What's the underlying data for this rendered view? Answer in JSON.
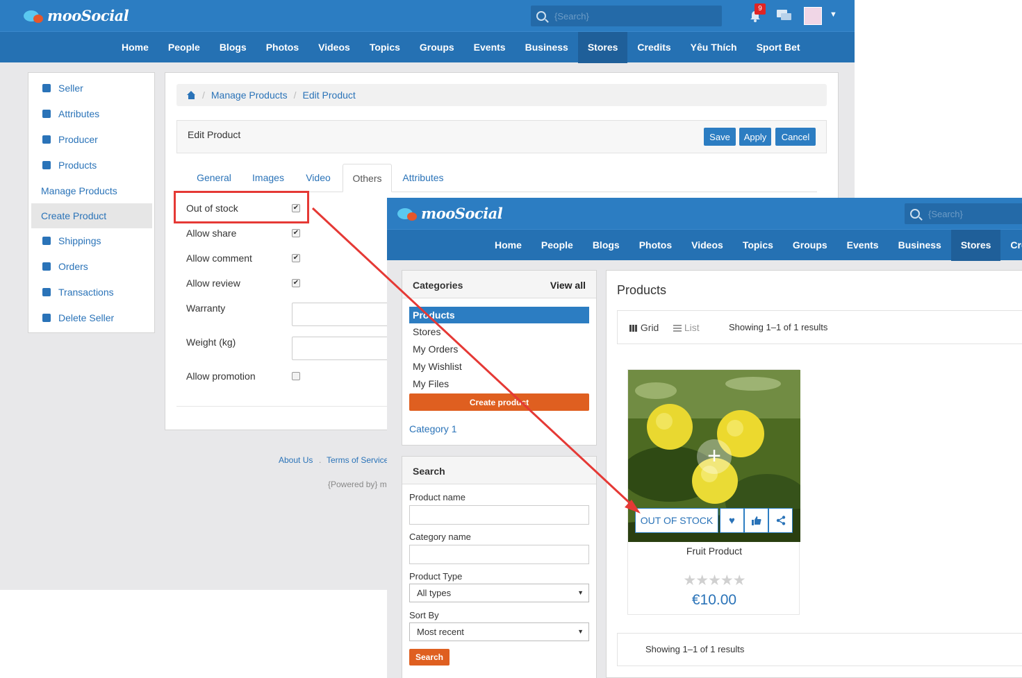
{
  "brand": "mooSocial",
  "search_placeholder": "{Search}",
  "notification_count": "9",
  "nav": [
    "Home",
    "People",
    "Blogs",
    "Photos",
    "Videos",
    "Topics",
    "Groups",
    "Events",
    "Business",
    "Stores",
    "Credits",
    "Yêu Thích",
    "Sport Bet"
  ],
  "front_nav": [
    "Home",
    "People",
    "Blogs",
    "Photos",
    "Videos",
    "Topics",
    "Groups",
    "Events",
    "Business",
    "Stores",
    "Credits"
  ],
  "sidebar": [
    "Seller",
    "Attributes",
    "Producer",
    "Products",
    "Manage Products",
    "Create Product",
    "Shippings",
    "Orders",
    "Transactions",
    "Delete Seller"
  ],
  "breadcrumb": {
    "manage": "Manage Products",
    "edit": "Edit Product"
  },
  "edit_header": {
    "title": "Edit Product",
    "save": "Save",
    "apply": "Apply",
    "cancel": "Cancel"
  },
  "tabs": [
    "General",
    "Images",
    "Video",
    "Others",
    "Attributes"
  ],
  "options": [
    {
      "label": "Out of stock",
      "checked": true
    },
    {
      "label": "Allow share",
      "checked": true
    },
    {
      "label": "Allow comment",
      "checked": true
    },
    {
      "label": "Allow review",
      "checked": true
    },
    {
      "label": "Warranty"
    },
    {
      "label": "Weight (kg)"
    },
    {
      "label": "Allow promotion",
      "checked": false
    }
  ],
  "footer": {
    "about": "About Us",
    "terms": "Terms of Service",
    "powered": "{Powered by} m"
  },
  "categories": {
    "title": "Categories",
    "view_all": "View all",
    "items": [
      "Products",
      "Stores",
      "My Orders",
      "My Wishlist",
      "My Files"
    ],
    "create_btn": "Create product",
    "category1": "Category 1"
  },
  "search_panel": {
    "title": "Search",
    "product_name": "Product name",
    "category_name": "Category name",
    "product_type": "Product Type",
    "product_type_value": "All types",
    "sort_by": "Sort By",
    "sort_value": "Most recent",
    "button": "Search"
  },
  "products": {
    "title": "Products",
    "grid": "Grid",
    "list": "List",
    "showing": "Showing 1–1 of 1 results",
    "item": {
      "oos": "OUT OF STOCK",
      "name": "Fruit Product",
      "price": "€10.00",
      "rating": 0
    }
  },
  "colors": {
    "primary": "#2c7dc2",
    "orange": "#df5f20",
    "highlight": "#e53935"
  }
}
